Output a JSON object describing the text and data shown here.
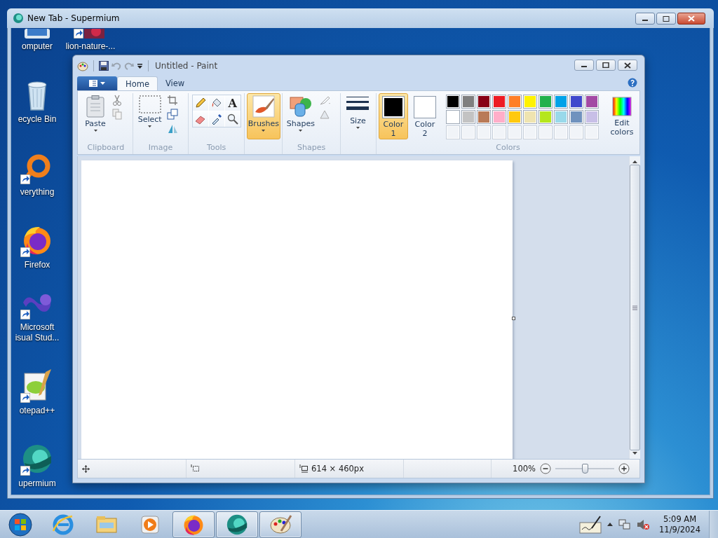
{
  "browser_window": {
    "title": "New Tab - Supermium"
  },
  "desktop_icons": [
    {
      "label": "omputer",
      "kind": "computer",
      "shortcut": false
    },
    {
      "label": "ecycle Bin",
      "kind": "recycle-bin",
      "shortcut": false
    },
    {
      "label": "verything",
      "kind": "everything",
      "shortcut": true
    },
    {
      "label": "Firefox",
      "kind": "firefox",
      "shortcut": true
    },
    {
      "label": "Microsoft isual Stud...",
      "kind": "visual-studio",
      "shortcut": true
    },
    {
      "label": "otepad++",
      "kind": "notepad",
      "shortcut": true
    },
    {
      "label": "upermium",
      "kind": "supermium",
      "shortcut": true
    },
    {
      "label": "lion-nature-...",
      "kind": "image",
      "shortcut": true
    }
  ],
  "paint": {
    "title": "Untitled - Paint",
    "tabs": [
      {
        "label": "Home",
        "selected": true
      },
      {
        "label": "View",
        "selected": false
      }
    ],
    "groups": [
      {
        "kind": "clipboard",
        "label": "Clipboard",
        "buttons": [
          {
            "label": "Paste",
            "selected": false
          }
        ]
      },
      {
        "kind": "image",
        "label": "Image",
        "buttons": [
          {
            "label": "Select",
            "selected": false
          }
        ]
      },
      {
        "kind": "tools",
        "label": "Tools",
        "text_tool": "A"
      },
      {
        "kind": "brushes",
        "buttons": [
          {
            "label": "Brushes",
            "selected": true
          }
        ]
      },
      {
        "kind": "shapes",
        "label": "Shapes",
        "buttons": [
          {
            "label": "Shapes",
            "selected": false
          }
        ]
      },
      {
        "kind": "size",
        "buttons": [
          {
            "label": "Size",
            "selected": false
          }
        ]
      },
      {
        "kind": "colors",
        "label": "Colors",
        "color_slots": [
          {
            "label": "Color 1",
            "color": "#000000",
            "selected": true
          },
          {
            "label": "Color 2",
            "color": "#ffffff",
            "selected": false
          }
        ],
        "palette": [
          {
            "color": "#000000"
          },
          {
            "color": "#7f7f7f"
          },
          {
            "color": "#880015"
          },
          {
            "color": "#ed1c24"
          },
          {
            "color": "#ff7f27"
          },
          {
            "color": "#fff200"
          },
          {
            "color": "#22b14c"
          },
          {
            "color": "#00a2e8"
          },
          {
            "color": "#3f48cc"
          },
          {
            "color": "#a349a4"
          },
          {
            "color": "#ffffff"
          },
          {
            "color": "#c3c3c3"
          },
          {
            "color": "#b97a57"
          },
          {
            "color": "#ffaec9"
          },
          {
            "color": "#ffc90e"
          },
          {
            "color": "#efe4b0"
          },
          {
            "color": "#b5e61d"
          },
          {
            "color": "#99d9ea"
          },
          {
            "color": "#7092be"
          },
          {
            "color": "#c8bfe7"
          }
        ],
        "edit_button": {
          "label": "Edit colors"
        }
      }
    ],
    "status_bar": {
      "image_size": "614 × 460px",
      "zoom": "100%",
      "zoom_slider": {
        "level": 0.5
      }
    }
  },
  "taskbar": {
    "items": [
      {
        "kind": "start",
        "open": false
      },
      {
        "kind": "internet-explorer",
        "open": false
      },
      {
        "kind": "file-explorer",
        "open": false
      },
      {
        "kind": "media-player",
        "open": false
      },
      {
        "kind": "firefox",
        "open": true
      },
      {
        "kind": "supermium",
        "open": true
      },
      {
        "kind": "paint",
        "open": true
      }
    ],
    "tray": {
      "volume_muted": true,
      "time": "5:09 AM",
      "date": "11/9/2024"
    }
  }
}
